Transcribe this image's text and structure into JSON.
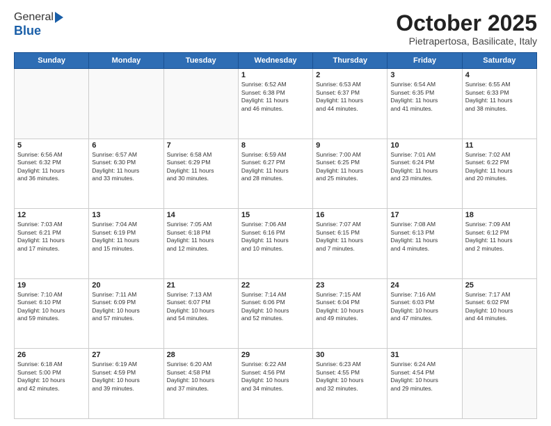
{
  "header": {
    "logo_general": "General",
    "logo_blue": "Blue",
    "month_title": "October 2025",
    "subtitle": "Pietrapertosa, Basilicate, Italy"
  },
  "weekdays": [
    "Sunday",
    "Monday",
    "Tuesday",
    "Wednesday",
    "Thursday",
    "Friday",
    "Saturday"
  ],
  "weeks": [
    [
      {
        "day": "",
        "info": ""
      },
      {
        "day": "",
        "info": ""
      },
      {
        "day": "",
        "info": ""
      },
      {
        "day": "1",
        "info": "Sunrise: 6:52 AM\nSunset: 6:38 PM\nDaylight: 11 hours\nand 46 minutes."
      },
      {
        "day": "2",
        "info": "Sunrise: 6:53 AM\nSunset: 6:37 PM\nDaylight: 11 hours\nand 44 minutes."
      },
      {
        "day": "3",
        "info": "Sunrise: 6:54 AM\nSunset: 6:35 PM\nDaylight: 11 hours\nand 41 minutes."
      },
      {
        "day": "4",
        "info": "Sunrise: 6:55 AM\nSunset: 6:33 PM\nDaylight: 11 hours\nand 38 minutes."
      }
    ],
    [
      {
        "day": "5",
        "info": "Sunrise: 6:56 AM\nSunset: 6:32 PM\nDaylight: 11 hours\nand 36 minutes."
      },
      {
        "day": "6",
        "info": "Sunrise: 6:57 AM\nSunset: 6:30 PM\nDaylight: 11 hours\nand 33 minutes."
      },
      {
        "day": "7",
        "info": "Sunrise: 6:58 AM\nSunset: 6:29 PM\nDaylight: 11 hours\nand 30 minutes."
      },
      {
        "day": "8",
        "info": "Sunrise: 6:59 AM\nSunset: 6:27 PM\nDaylight: 11 hours\nand 28 minutes."
      },
      {
        "day": "9",
        "info": "Sunrise: 7:00 AM\nSunset: 6:25 PM\nDaylight: 11 hours\nand 25 minutes."
      },
      {
        "day": "10",
        "info": "Sunrise: 7:01 AM\nSunset: 6:24 PM\nDaylight: 11 hours\nand 23 minutes."
      },
      {
        "day": "11",
        "info": "Sunrise: 7:02 AM\nSunset: 6:22 PM\nDaylight: 11 hours\nand 20 minutes."
      }
    ],
    [
      {
        "day": "12",
        "info": "Sunrise: 7:03 AM\nSunset: 6:21 PM\nDaylight: 11 hours\nand 17 minutes."
      },
      {
        "day": "13",
        "info": "Sunrise: 7:04 AM\nSunset: 6:19 PM\nDaylight: 11 hours\nand 15 minutes."
      },
      {
        "day": "14",
        "info": "Sunrise: 7:05 AM\nSunset: 6:18 PM\nDaylight: 11 hours\nand 12 minutes."
      },
      {
        "day": "15",
        "info": "Sunrise: 7:06 AM\nSunset: 6:16 PM\nDaylight: 11 hours\nand 10 minutes."
      },
      {
        "day": "16",
        "info": "Sunrise: 7:07 AM\nSunset: 6:15 PM\nDaylight: 11 hours\nand 7 minutes."
      },
      {
        "day": "17",
        "info": "Sunrise: 7:08 AM\nSunset: 6:13 PM\nDaylight: 11 hours\nand 4 minutes."
      },
      {
        "day": "18",
        "info": "Sunrise: 7:09 AM\nSunset: 6:12 PM\nDaylight: 11 hours\nand 2 minutes."
      }
    ],
    [
      {
        "day": "19",
        "info": "Sunrise: 7:10 AM\nSunset: 6:10 PM\nDaylight: 10 hours\nand 59 minutes."
      },
      {
        "day": "20",
        "info": "Sunrise: 7:11 AM\nSunset: 6:09 PM\nDaylight: 10 hours\nand 57 minutes."
      },
      {
        "day": "21",
        "info": "Sunrise: 7:13 AM\nSunset: 6:07 PM\nDaylight: 10 hours\nand 54 minutes."
      },
      {
        "day": "22",
        "info": "Sunrise: 7:14 AM\nSunset: 6:06 PM\nDaylight: 10 hours\nand 52 minutes."
      },
      {
        "day": "23",
        "info": "Sunrise: 7:15 AM\nSunset: 6:04 PM\nDaylight: 10 hours\nand 49 minutes."
      },
      {
        "day": "24",
        "info": "Sunrise: 7:16 AM\nSunset: 6:03 PM\nDaylight: 10 hours\nand 47 minutes."
      },
      {
        "day": "25",
        "info": "Sunrise: 7:17 AM\nSunset: 6:02 PM\nDaylight: 10 hours\nand 44 minutes."
      }
    ],
    [
      {
        "day": "26",
        "info": "Sunrise: 6:18 AM\nSunset: 5:00 PM\nDaylight: 10 hours\nand 42 minutes."
      },
      {
        "day": "27",
        "info": "Sunrise: 6:19 AM\nSunset: 4:59 PM\nDaylight: 10 hours\nand 39 minutes."
      },
      {
        "day": "28",
        "info": "Sunrise: 6:20 AM\nSunset: 4:58 PM\nDaylight: 10 hours\nand 37 minutes."
      },
      {
        "day": "29",
        "info": "Sunrise: 6:22 AM\nSunset: 4:56 PM\nDaylight: 10 hours\nand 34 minutes."
      },
      {
        "day": "30",
        "info": "Sunrise: 6:23 AM\nSunset: 4:55 PM\nDaylight: 10 hours\nand 32 minutes."
      },
      {
        "day": "31",
        "info": "Sunrise: 6:24 AM\nSunset: 4:54 PM\nDaylight: 10 hours\nand 29 minutes."
      },
      {
        "day": "",
        "info": ""
      }
    ]
  ]
}
